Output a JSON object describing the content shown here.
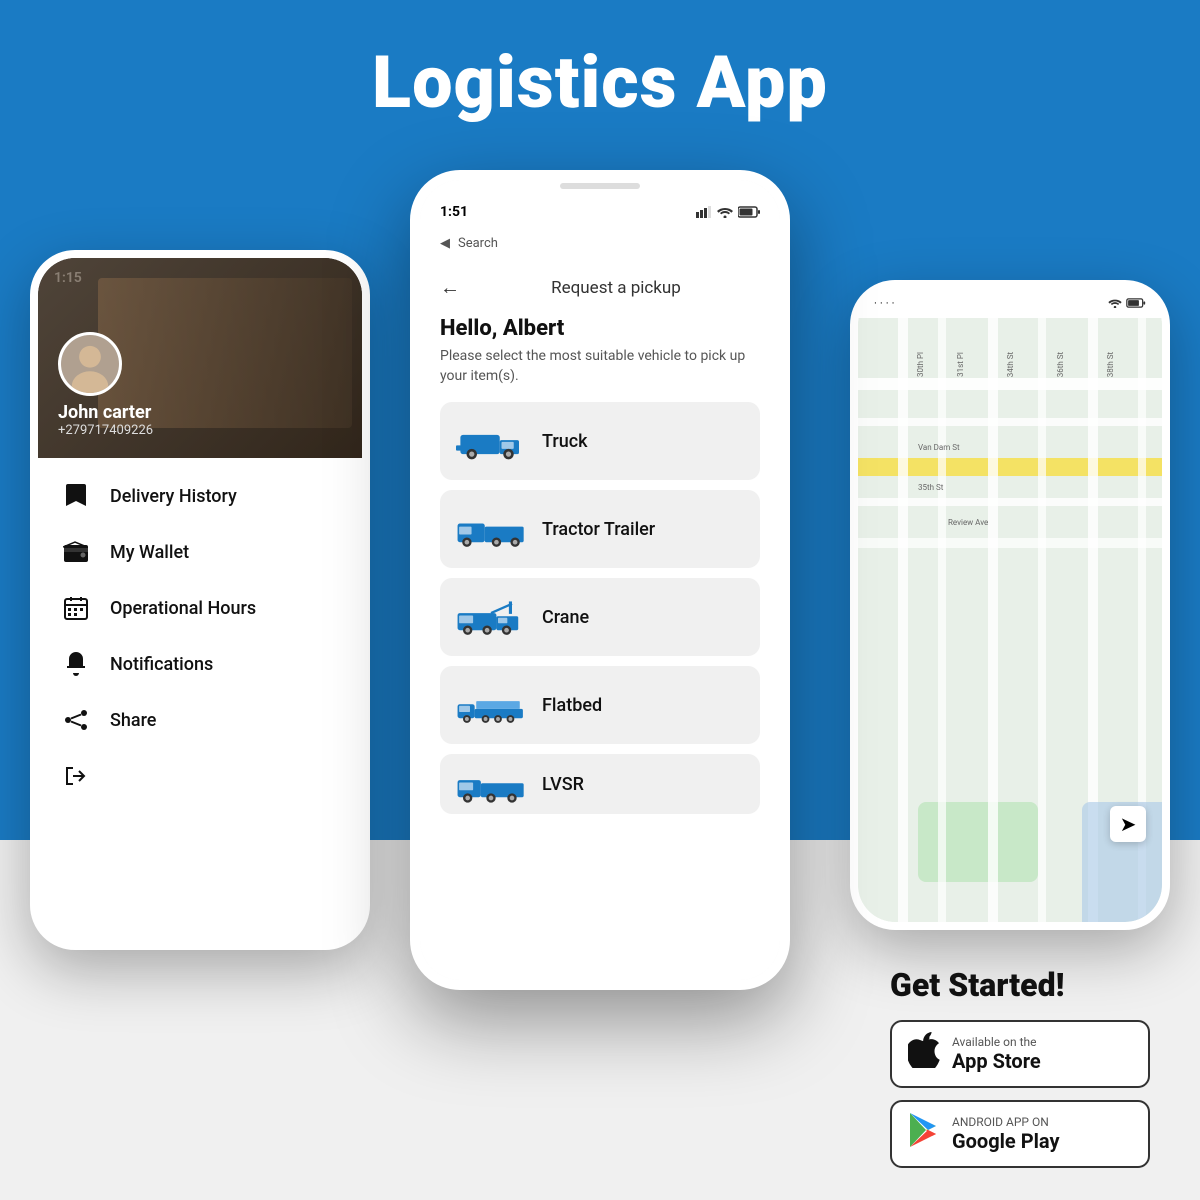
{
  "page": {
    "title": "Logistics App",
    "background_color": "#1a7bc4"
  },
  "left_phone": {
    "time": "1:15",
    "user": {
      "name": "John carter",
      "phone": "+279717409226"
    },
    "menu_items": [
      {
        "id": "delivery-history",
        "label": "Delivery History",
        "icon": "bookmark"
      },
      {
        "id": "my-wallet",
        "label": "My Wallet",
        "icon": "wallet"
      },
      {
        "id": "operational-hours",
        "label": "Operational Hours",
        "icon": "calendar"
      },
      {
        "id": "notifications",
        "label": "Notifications",
        "icon": "bell"
      },
      {
        "id": "share",
        "label": "Share",
        "icon": "share"
      },
      {
        "id": "logout",
        "label": "",
        "icon": "logout"
      }
    ]
  },
  "center_phone": {
    "time": "1:51",
    "search_label": "Search",
    "screen_title": "Request a pickup",
    "greeting": "Hello, Albert",
    "instruction": "Please select the most suitable vehicle to pick up your item(s).",
    "vehicles": [
      {
        "id": "truck",
        "name": "Truck"
      },
      {
        "id": "tractor-trailer",
        "name": "Tractor Trailer"
      },
      {
        "id": "crane",
        "name": "Crane"
      },
      {
        "id": "flatbed",
        "name": "Flatbed"
      },
      {
        "id": "lvsr",
        "name": "LVSR"
      }
    ]
  },
  "right_phone": {
    "status_dots": "....",
    "wifi_icon": "wifi",
    "battery_icon": "battery"
  },
  "cta": {
    "heading": "Get Started!",
    "app_store": {
      "label_small": "Available on the",
      "label_big": "App Store"
    },
    "google_play": {
      "label_small": "ANDROID APP ON",
      "label_big": "Google Play"
    }
  }
}
